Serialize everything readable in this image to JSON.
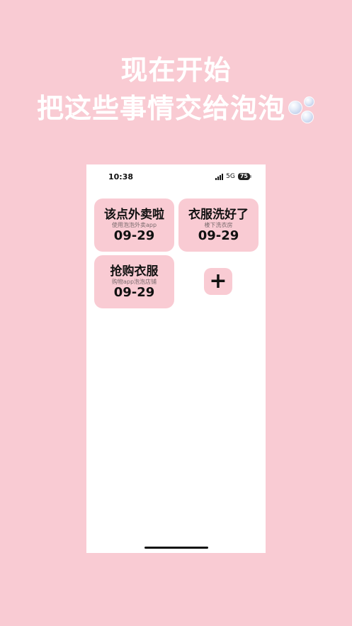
{
  "promo": {
    "line1": "现在开始",
    "line2": "把这些事情交给泡泡"
  },
  "status_bar": {
    "time": "10:38",
    "network": "5G",
    "battery": "75"
  },
  "tasks": [
    {
      "title": "该点外卖啦",
      "subtitle": "使用泡泡外卖app",
      "date": "09-29"
    },
    {
      "title": "衣服洗好了",
      "subtitle": "楼下洗衣房",
      "date": "09-29"
    },
    {
      "title": "抢购衣服",
      "subtitle": "购物app泡泡店铺",
      "date": "09-29"
    }
  ],
  "add_button": {
    "label": "+"
  },
  "colors": {
    "background": "#f9cbd3",
    "card": "#f9cbd3",
    "screen": "#ffffff",
    "text": "#111111"
  },
  "icons": [
    "signal-icon",
    "battery-icon",
    "bubbles-icon"
  ]
}
